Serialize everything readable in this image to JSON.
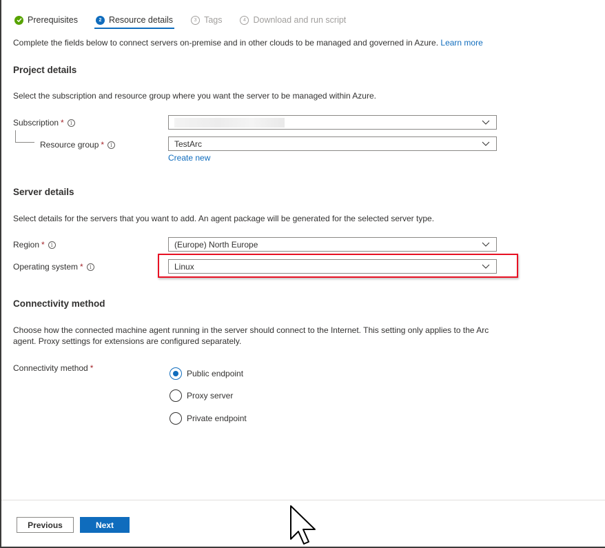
{
  "tabs": [
    {
      "label": "Prerequisites",
      "state": "done",
      "icon": "check-icon"
    },
    {
      "label": "Resource details",
      "state": "active",
      "step": "2"
    },
    {
      "label": "Tags",
      "state": "disabled",
      "step": "3"
    },
    {
      "label": "Download and run script",
      "state": "disabled",
      "step": "4"
    }
  ],
  "intro": {
    "text": "Complete the fields below to connect servers on-premise and in other clouds to be managed and governed in Azure.",
    "link": "Learn more"
  },
  "project": {
    "heading": "Project details",
    "description": "Select the subscription and resource group where you want the server to be managed within Azure.",
    "subscription_label": "Subscription",
    "subscription_value": "",
    "resource_group_label": "Resource group",
    "resource_group_value": "TestArc",
    "create_new": "Create new"
  },
  "server": {
    "heading": "Server details",
    "description": "Select details for the servers that you want to add. An agent package will be generated for the selected server type.",
    "region_label": "Region",
    "region_value": "(Europe) North Europe",
    "os_label": "Operating system",
    "os_value": "Linux"
  },
  "connectivity": {
    "heading": "Connectivity method",
    "description_line1": "Choose how the connected machine agent running in the server should connect to the Internet. This setting only applies to the Arc",
    "description_line2": "agent. Proxy settings for extensions are configured separately.",
    "label": "Connectivity method",
    "options": [
      "Public endpoint",
      "Proxy server",
      "Private endpoint"
    ],
    "selected": "Public endpoint"
  },
  "required_mark": "*",
  "footer": {
    "previous": "Previous",
    "next": "Next"
  },
  "colors": {
    "accent": "#0f6cbd",
    "success": "#57a300",
    "highlight": "#e81123"
  }
}
